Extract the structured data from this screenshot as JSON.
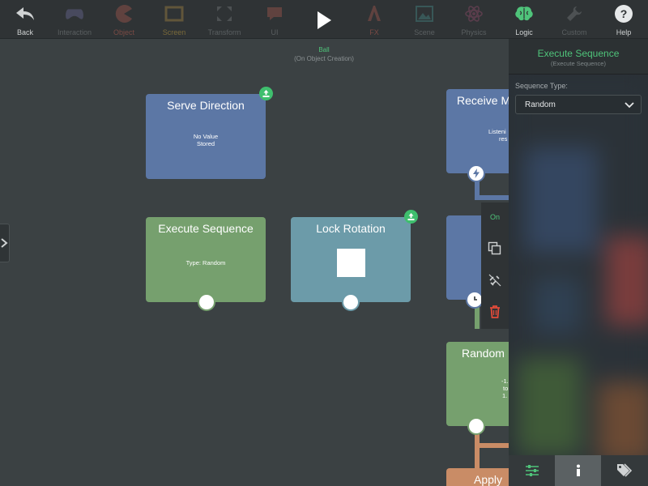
{
  "toolbar": {
    "items": [
      {
        "id": "back",
        "label": "Back",
        "icon": "back-arrow-icon",
        "color": "#cfd2d3"
      },
      {
        "id": "interaction",
        "label": "Interaction",
        "icon": "gamepad-icon",
        "color": "#8a86c8"
      },
      {
        "id": "object",
        "label": "Object",
        "icon": "pacman-icon",
        "color": "#e06a5a"
      },
      {
        "id": "screen",
        "label": "Screen",
        "icon": "screen-frame-icon",
        "color": "#e2b04a"
      },
      {
        "id": "transform",
        "label": "Transform",
        "icon": "expand-arrows-icon",
        "color": "#9aa0a3"
      },
      {
        "id": "ui",
        "label": "UI",
        "icon": "speech-bubble-icon",
        "color": "#e06a5a"
      },
      {
        "id": "play",
        "label": "",
        "icon": "play-icon",
        "color": "#ffffff"
      },
      {
        "id": "fx",
        "label": "FX",
        "icon": "fx-letter-icon",
        "color": "#e06a5a"
      },
      {
        "id": "scene",
        "label": "Scene",
        "icon": "landscape-icon",
        "color": "#4fb3b0"
      },
      {
        "id": "physics",
        "label": "Physics",
        "icon": "atom-icon",
        "color": "#c85a8a"
      },
      {
        "id": "logic",
        "label": "Logic",
        "icon": "brain-icon",
        "color": "#4fc47a"
      },
      {
        "id": "custom",
        "label": "Custom",
        "icon": "wrench-icon",
        "color": "#9aa0a3"
      },
      {
        "id": "help",
        "label": "Help",
        "icon": "help-icon",
        "color": "#e6e8e9"
      }
    ]
  },
  "canvas": {
    "object_name": "Ball",
    "object_event": "(On Object Creation)"
  },
  "blocks": {
    "serve_direction": {
      "title": "Serve Direction",
      "body_line1": "No Value",
      "body_line2": "Stored"
    },
    "execute_sequence": {
      "title": "Execute Sequence",
      "body": "Type: Random"
    },
    "lock_rotation": {
      "title": "Lock Rotation"
    },
    "receive_message": {
      "title": "Receive M",
      "body_line1": "Listeni",
      "body_line2": "res"
    },
    "random": {
      "title": "Random",
      "body_line1": "-1.",
      "body_line2": "to",
      "body_line3": "1."
    },
    "apply": {
      "title": "Apply"
    }
  },
  "context_menu": {
    "toggle_label": "On",
    "items": [
      "copy-icon",
      "unlink-icon",
      "trash-icon"
    ]
  },
  "panel": {
    "title": "Execute Sequence",
    "subtitle": "(Execute Sequence)",
    "field_label": "Sequence Type:",
    "field_value": "Random",
    "tabs": [
      "sliders-icon",
      "info-icon",
      "tags-icon"
    ]
  },
  "colors": {
    "accent_green": "#4fc47a",
    "block_blue": "#5c77a5",
    "block_green": "#76a06e",
    "block_teal": "#6c9ba9",
    "block_orange": "#c98c66"
  }
}
